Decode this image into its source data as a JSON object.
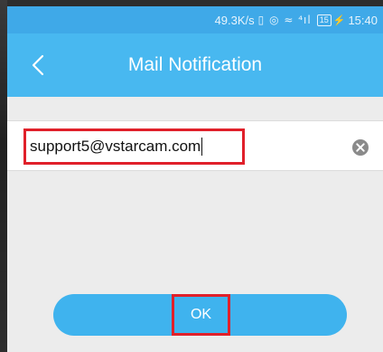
{
  "status_bar": {
    "speed": "49.3K/s",
    "icons": "▯ ◎ ≈ ⁴ıl",
    "battery": "15",
    "charging": "⚡",
    "time": "15:40"
  },
  "app_bar": {
    "title": "Mail Notification",
    "back_icon": "chevron-left-icon"
  },
  "form": {
    "email_value": "support5@vstarcam.com",
    "clear_icon": "clear-circle-icon"
  },
  "actions": {
    "ok_label": "OK"
  },
  "colors": {
    "header": "#48b8f0",
    "status": "#3fa9e8",
    "button": "#3fb3ee",
    "highlight": "#e0202a"
  }
}
